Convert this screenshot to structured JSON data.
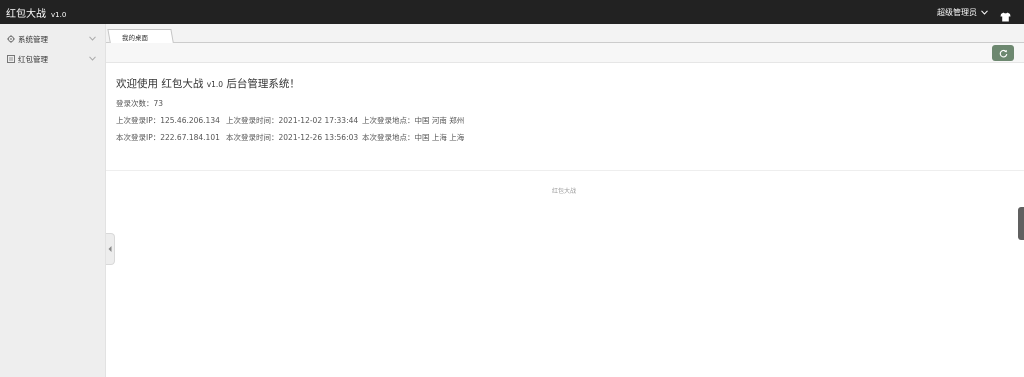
{
  "header": {
    "app_name": "红包大战",
    "version": "v1.0",
    "user_role": "超级管理员"
  },
  "sidebar": {
    "items": [
      {
        "label": "系统管理"
      },
      {
        "label": "红包管理"
      }
    ]
  },
  "tabs": [
    {
      "label": "我的桌面"
    }
  ],
  "welcome": {
    "prefix": "欢迎使用 红包大战",
    "version": "v1.0",
    "suffix": "后台管理系统！"
  },
  "stats": {
    "login_count": "登录次数：73",
    "last_ip": "上次登录IP：125.46.206.134",
    "last_time": "上次登录时间：2021-12-02 17:33:44",
    "last_location": "上次登录地点：中国 河南 郑州",
    "current_ip": "本次登录IP：222.67.184.101",
    "current_time": "本次登录时间：2021-12-26 13:56:03",
    "current_location": "本次登录地点：中国 上海 上海"
  },
  "footer": {
    "text": "红包大战"
  },
  "colors": {
    "topbar": "#222222",
    "sidebar": "#eeeeee",
    "refresh_button": "#6d8870"
  }
}
